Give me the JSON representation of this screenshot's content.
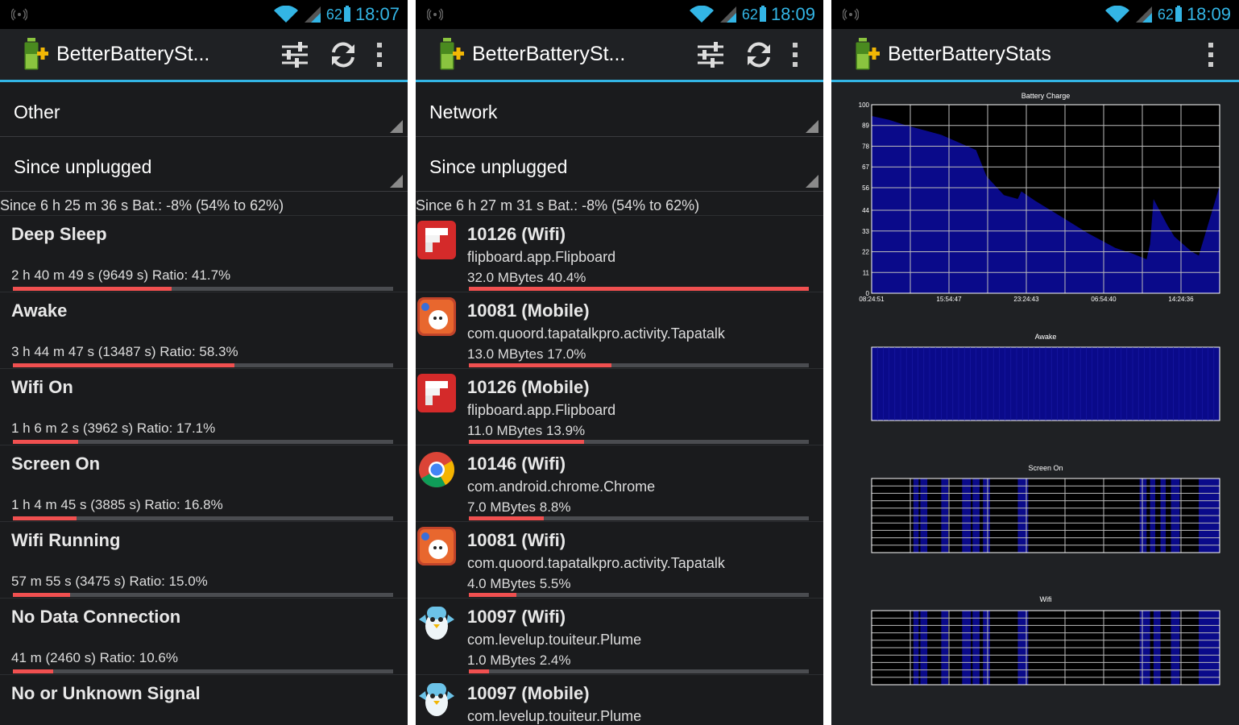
{
  "status": {
    "p1_battery": "62",
    "p1_time": "18:07",
    "p2_battery": "62",
    "p2_time": "18:09",
    "p3_battery": "62",
    "p3_time": "18:09"
  },
  "app": {
    "title_short": "BetterBatterySt...",
    "title_full": "BetterBatteryStats"
  },
  "icons": {
    "app": "battery-plus-icon",
    "filter": "sliders-icon",
    "refresh": "refresh-icon",
    "overflow": "overflow-icon",
    "notify": "wireless-notification-icon",
    "wifi": "wifi-icon",
    "signal": "signal-icon"
  },
  "colors": {
    "accent": "#33b5e5",
    "bar_fill": "#f05050",
    "bar_track": "#4a4c50",
    "chart_fill": "#0a0a8a"
  },
  "screen1": {
    "spinner1": "Other",
    "spinner2": "Since unplugged",
    "since": "Since 6 h 25 m 36 s  Bat.: -8% (54% to 62%)",
    "rows": [
      {
        "name": "Deep Sleep",
        "detail": "2 h 40 m 49 s  (9649 s) Ratio: 41.7%",
        "ratio": 0.417
      },
      {
        "name": "Awake",
        "detail": "3 h 44 m 47 s  (13487 s) Ratio: 58.3%",
        "ratio": 0.583
      },
      {
        "name": "Wifi On",
        "detail": "1 h 6 m 2 s  (3962 s) Ratio: 17.1%",
        "ratio": 0.171
      },
      {
        "name": "Screen On",
        "detail": "1 h 4 m 45 s  (3885 s) Ratio: 16.8%",
        "ratio": 0.168
      },
      {
        "name": "Wifi Running",
        "detail": "57 m 55 s  (3475 s) Ratio: 15.0%",
        "ratio": 0.15
      },
      {
        "name": "No Data Connection",
        "detail": "41 m  (2460 s) Ratio: 10.6%",
        "ratio": 0.106
      },
      {
        "name": "No or Unknown Signal",
        "detail": "",
        "ratio": null
      }
    ]
  },
  "screen2": {
    "spinner1": "Network",
    "spinner2": "Since unplugged",
    "since": "Since 6 h 27 m 31 s  Bat.: -8% (54% to 62%)",
    "rows": [
      {
        "title": "10126 (Wifi)",
        "pkg": "flipboard.app.Flipboard",
        "usage": "32.0 MBytes 40.4%",
        "ratio": 1.0,
        "icon": "flipboard-icon"
      },
      {
        "title": "10081 (Mobile)",
        "pkg": "com.quoord.tapatalkpro.activity.Tapatalk",
        "usage": "13.0 MBytes 17.0%",
        "ratio": 0.42,
        "icon": "tapatalk-icon"
      },
      {
        "title": "10126 (Mobile)",
        "pkg": "flipboard.app.Flipboard",
        "usage": "11.0 MBytes 13.9%",
        "ratio": 0.34,
        "icon": "flipboard-icon"
      },
      {
        "title": "10146 (Wifi)",
        "pkg": "com.android.chrome.Chrome",
        "usage": "7.0 MBytes 8.8%",
        "ratio": 0.22,
        "icon": "chrome-icon"
      },
      {
        "title": "10081 (Wifi)",
        "pkg": "com.quoord.tapatalkpro.activity.Tapatalk",
        "usage": "4.0 MBytes 5.5%",
        "ratio": 0.14,
        "icon": "tapatalk-icon"
      },
      {
        "title": "10097 (Wifi)",
        "pkg": "com.levelup.touiteur.Plume",
        "usage": "1.0 MBytes 2.4%",
        "ratio": 0.06,
        "icon": "plume-icon"
      },
      {
        "title": "10097 (Mobile)",
        "pkg": "com.levelup.touiteur.Plume",
        "usage": "",
        "ratio": null,
        "icon": "plume-icon"
      }
    ]
  },
  "chart_data": [
    {
      "type": "area",
      "title": "Battery Charge",
      "ylim": [
        0,
        100
      ],
      "yticks": [
        "0",
        "11",
        "22",
        "33",
        "44",
        "56",
        "67",
        "78",
        "89",
        "100"
      ],
      "xticks": [
        "08:24:51",
        "15:54:47",
        "23:24:43",
        "06:54:40",
        "14:24:36"
      ],
      "series": [
        {
          "values": [
            [
              0,
              94
            ],
            [
              0.05,
              92
            ],
            [
              0.1,
              89
            ],
            [
              0.2,
              84
            ],
            [
              0.3,
              76
            ],
            [
              0.33,
              62
            ],
            [
              0.38,
              52
            ],
            [
              0.42,
              50
            ],
            [
              0.43,
              54
            ],
            [
              0.47,
              49
            ],
            [
              0.55,
              40
            ],
            [
              0.62,
              32
            ],
            [
              0.7,
              24
            ],
            [
              0.75,
              21
            ],
            [
              0.79,
              18
            ],
            [
              0.8,
              26
            ],
            [
              0.81,
              50
            ],
            [
              0.85,
              36
            ],
            [
              0.87,
              30
            ],
            [
              0.92,
              22
            ],
            [
              0.94,
              20
            ],
            [
              1.0,
              57
            ]
          ]
        }
      ]
    },
    {
      "type": "area",
      "title": "Awake",
      "series": [
        {
          "values": [
            [
              0,
              1
            ],
            [
              1,
              1
            ]
          ]
        }
      ]
    },
    {
      "type": "bar",
      "title": "Screen On",
      "intervals": [
        [
          0.12,
          0.135
        ],
        [
          0.14,
          0.16
        ],
        [
          0.2,
          0.22
        ],
        [
          0.26,
          0.285
        ],
        [
          0.29,
          0.31
        ],
        [
          0.32,
          0.34
        ],
        [
          0.42,
          0.45
        ],
        [
          0.77,
          0.79
        ],
        [
          0.8,
          0.815
        ],
        [
          0.83,
          0.845
        ],
        [
          0.86,
          0.885
        ],
        [
          0.94,
          1.0
        ]
      ]
    },
    {
      "type": "bar",
      "title": "Wifi",
      "intervals": [
        [
          0.12,
          0.135
        ],
        [
          0.14,
          0.16
        ],
        [
          0.2,
          0.22
        ],
        [
          0.26,
          0.285
        ],
        [
          0.29,
          0.31
        ],
        [
          0.32,
          0.34
        ],
        [
          0.42,
          0.45
        ],
        [
          0.77,
          0.8
        ],
        [
          0.81,
          0.83
        ],
        [
          0.86,
          0.885
        ],
        [
          0.94,
          1.0
        ]
      ]
    }
  ]
}
